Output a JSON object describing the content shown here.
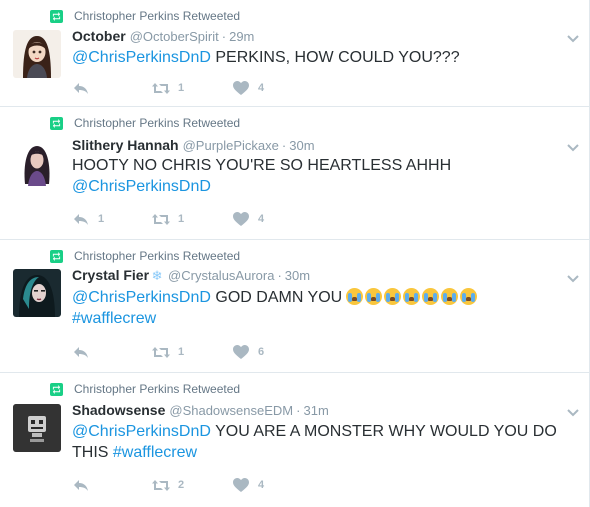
{
  "tweets": [
    {
      "retweet_context": "Christopher Perkins Retweeted",
      "name": "October",
      "handle": "@OctoberSpirit",
      "time": "29m",
      "mention": "@ChrisPerkinsDnD",
      "text": " PERKINS, HOW COULD YOU???",
      "replies": "",
      "retweets": "1",
      "likes": "4"
    },
    {
      "retweet_context": "Christopher Perkins Retweeted",
      "name": "Slithery Hannah",
      "handle": "@PurplePickaxe",
      "time": "30m",
      "text_line1": "HOOTY NO CHRIS YOU'RE SO HEARTLESS AHHH",
      "mention": "@ChrisPerkinsDnD",
      "replies": "1",
      "retweets": "1",
      "likes": "4"
    },
    {
      "retweet_context": "Christopher Perkins Retweeted",
      "name": "Crystal Fier",
      "name_emoji": "❄",
      "handle": "@CrystalusAurora",
      "time": "30m",
      "mention": "@ChrisPerkinsDnD",
      "text": " GOD DAMN YOU",
      "hashtag": "#wafflecrew",
      "replies": "",
      "retweets": "1",
      "likes": "6"
    },
    {
      "retweet_context": "Christopher Perkins Retweeted",
      "name": "Shadowsense",
      "handle": "@ShadowsenseEDM",
      "time": "31m",
      "mention": "@ChrisPerkinsDnD",
      "text": " YOU ARE A MONSTER WHY WOULD YOU DO",
      "text_line2": "THIS ",
      "hashtag": "#wafflecrew",
      "replies": "",
      "retweets": "2",
      "likes": "4"
    }
  ],
  "icons": {
    "retweet_badge": "retweet-icon",
    "reply": "reply-icon",
    "retweet": "retweet-icon",
    "like": "heart-icon",
    "menu": "chevron-down-icon",
    "sob_emoji": "loudly-crying-face-emoji"
  },
  "colors": {
    "link": "#1b95e0",
    "retweet_badge": "#19cf86",
    "muted": "#8899a6",
    "action_icon": "#aab8c2",
    "divider": "#e1e8ed"
  }
}
